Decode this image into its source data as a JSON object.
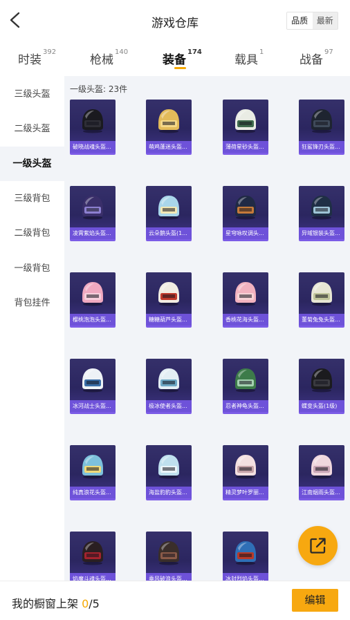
{
  "header": {
    "title": "游戏仓库",
    "sort_options": [
      "品质",
      "最新"
    ]
  },
  "tabs": [
    {
      "label": "时装",
      "count": "392"
    },
    {
      "label": "枪械",
      "count": "140"
    },
    {
      "label": "装备",
      "count": "174"
    },
    {
      "label": "载具",
      "count": "1"
    },
    {
      "label": "战备",
      "count": "97"
    }
  ],
  "active_tab": "装备",
  "sidebar": {
    "items": [
      "三级头盔",
      "二级头盔",
      "一级头盔",
      "三级背包",
      "二级背包",
      "一级背包",
      "背包挂件"
    ],
    "active": "一级头盔"
  },
  "content": {
    "count_label": "一级头盔: 23件",
    "items": [
      {
        "name": "破晓战魂头盔...",
        "icon": "helmet-icon",
        "colors": [
          "#1a1a1f",
          "#2e2e36"
        ]
      },
      {
        "name": "萌鸡蓬迷头盔...",
        "icon": "helmet-icon",
        "colors": [
          "#e3bb5a",
          "#f4d889"
        ]
      },
      {
        "name": "薄荷星砂头盔...",
        "icon": "helmet-icon",
        "colors": [
          "#e9ece4",
          "#3f6b4d"
        ]
      },
      {
        "name": "狂鲨锋刃头盔...",
        "icon": "helmet-icon",
        "colors": [
          "#1e2430",
          "#3f4a5a"
        ]
      },
      {
        "name": "凌霄紫焰头盔...",
        "icon": "helmet-icon",
        "colors": [
          "#3a2f6a",
          "#8c7fd0"
        ]
      },
      {
        "name": "云朵鹅头盔(1...",
        "icon": "helmet-icon",
        "colors": [
          "#a9d6ea",
          "#f2e7b4"
        ]
      },
      {
        "name": "星穹咏叹调头...",
        "icon": "helmet-icon",
        "colors": [
          "#202a45",
          "#c47a3b"
        ]
      },
      {
        "name": "异域银装头盔...",
        "icon": "helmet-icon",
        "colors": [
          "#1f2f45",
          "#9ec3d6"
        ]
      },
      {
        "name": "樱桃泡泡头盔...",
        "icon": "helmet-icon",
        "colors": [
          "#f0a9c0",
          "#f7cfdc"
        ]
      },
      {
        "name": "糖糖葫芦头盔...",
        "icon": "helmet-icon",
        "colors": [
          "#f1ece2",
          "#c0392b"
        ]
      },
      {
        "name": "香桃花海头盔...",
        "icon": "helmet-icon",
        "colors": [
          "#f2b2bf",
          "#f6d2d6"
        ]
      },
      {
        "name": "董菊兔兔头盔...",
        "icon": "helmet-icon",
        "colors": [
          "#e7e6d4",
          "#bfc49a"
        ]
      },
      {
        "name": "冰河战士头盔...",
        "icon": "helmet-icon",
        "colors": [
          "#eef2f6",
          "#3a6ea8"
        ]
      },
      {
        "name": "极冰使者头盔...",
        "icon": "helmet-icon",
        "colors": [
          "#e3eef4",
          "#6ea9c6"
        ]
      },
      {
        "name": "忍者神龟头盔...",
        "icon": "helmet-icon",
        "colors": [
          "#3d7b4a",
          "#a4d0b0"
        ]
      },
      {
        "name": "蝶变头盔(1级)",
        "icon": "helmet-icon",
        "colors": [
          "#1b1b1e",
          "#3a3a40"
        ]
      },
      {
        "name": "纯真浪花头盔...",
        "icon": "helmet-icon",
        "colors": [
          "#7dc1dc",
          "#f0d97a"
        ]
      },
      {
        "name": "海盐豹豹头盔...",
        "icon": "helmet-icon",
        "colors": [
          "#bfe0ee",
          "#eaf4f8"
        ]
      },
      {
        "name": "精灵梦叶罗丽...",
        "icon": "helmet-icon",
        "colors": [
          "#f3dfe0",
          "#c6a3a8"
        ]
      },
      {
        "name": "江南烟雨头盔...",
        "icon": "helmet-icon",
        "colors": [
          "#f0d7de",
          "#caa6b6"
        ]
      },
      {
        "name": "焰魔斗魂头盔...",
        "icon": "helmet-icon",
        "colors": [
          "#2a1f22",
          "#a3232e"
        ]
      },
      {
        "name": "垂风破浪头盔...",
        "icon": "helmet-icon",
        "colors": [
          "#3a2e2a",
          "#8a5a48"
        ]
      },
      {
        "name": "冰封烈焰头盔...",
        "icon": "helmet-icon",
        "colors": [
          "#2f6fb6",
          "#b83a2a"
        ]
      }
    ]
  },
  "footer": {
    "text_prefix": "我的橱窗上架 ",
    "shelved": "0",
    "separator_total": "/5",
    "edit_label": "编辑"
  },
  "colors": {
    "accent": "#f7a810",
    "card_label_bg": "#6e52d9",
    "content_bg": "#f2f4f8"
  }
}
